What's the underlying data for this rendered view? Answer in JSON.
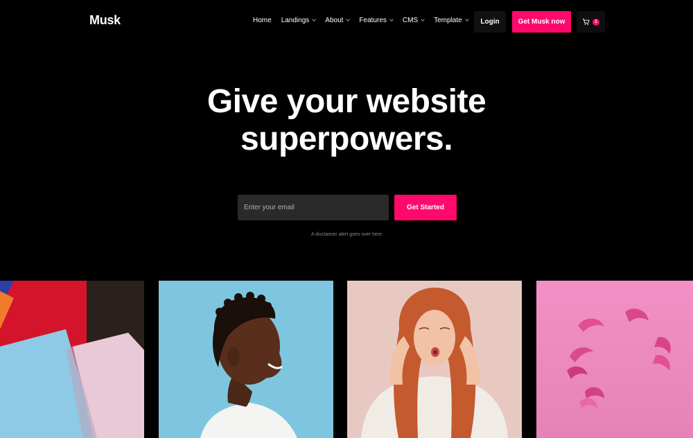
{
  "brand": {
    "logo": "Musk",
    "accent_color": "#ff0a6c"
  },
  "nav": {
    "items": [
      {
        "label": "Home",
        "has_dropdown": false
      },
      {
        "label": "Landings",
        "has_dropdown": true
      },
      {
        "label": "About",
        "has_dropdown": true
      },
      {
        "label": "Features",
        "has_dropdown": true
      },
      {
        "label": "CMS",
        "has_dropdown": true
      },
      {
        "label": "Template",
        "has_dropdown": true
      }
    ],
    "login_label": "Login",
    "cta_label": "Get Musk now",
    "cart_icon": "cart-icon",
    "cart_count": "1"
  },
  "hero": {
    "title_line1": "Give your website",
    "title_line2": "superpowers.",
    "email_placeholder": "Enter your email",
    "button_label": "Get Started",
    "disclaimer": "A disclaimer alert goes over here"
  },
  "gallery": [
    {
      "subject": "colorful paper sheets",
      "bg_color": "#ff6f8e"
    },
    {
      "subject": "smiling man profile",
      "bg_color": "#7ec6e0"
    },
    {
      "subject": "woman with red hair",
      "bg_color": "#e8c9c2"
    },
    {
      "subject": "pink floating shapes",
      "bg_color": "#f08cc0"
    }
  ]
}
